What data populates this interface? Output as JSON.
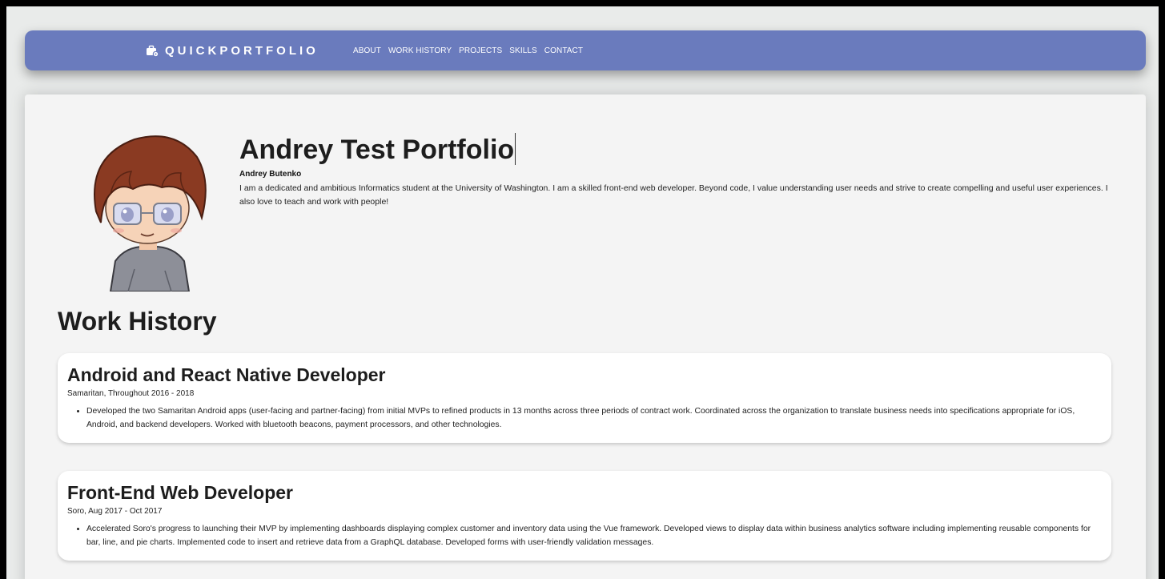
{
  "nav": {
    "brand": "QUICKPORTFOLIO",
    "brand_icon": "briefcase-gear-icon",
    "links": [
      "ABOUT",
      "WORK HISTORY",
      "PROJECTS",
      "SKILLS",
      "CONTACT"
    ]
  },
  "about": {
    "title": "Andrey Test Portfolio",
    "name": "Andrey Butenko",
    "bio": "I am a dedicated and ambitious Informatics student at the University of Washington. I am a skilled front-end web developer. Beyond code, I value understanding user needs and strive to create compelling and useful user experiences. I also love to teach and work with people!"
  },
  "work_history": {
    "heading": "Work History",
    "jobs": [
      {
        "title": "Android and React Native Developer",
        "meta": "Samaritan, Throughout 2016 - 2018",
        "bullets": [
          "Developed the two Samaritan Android apps (user-facing and partner-facing) from initial MVPs to refined products in 13 months across three periods of contract work. Coordinated across the organization to translate business needs into specifications appropriate for iOS, Android, and backend developers. Worked with bluetooth beacons, payment processors, and other technologies."
        ]
      },
      {
        "title": "Front-End Web Developer",
        "meta": "Soro, Aug 2017 - Oct 2017",
        "bullets": [
          "Accelerated Soro's progress to launching their MVP by implementing dashboards displaying complex customer and inventory data using the Vue framework. Developed views to display data within business analytics software including implementing reusable components for bar, line, and pie charts. Implemented code to insert and retrieve data from a GraphQL database. Developed forms with user-friendly validation messages."
        ]
      }
    ]
  },
  "colors": {
    "navbar": "#6a7bbd",
    "page_bg": "#e9ebea",
    "content_bg": "#f4f4f4",
    "card_bg": "#ffffff"
  }
}
